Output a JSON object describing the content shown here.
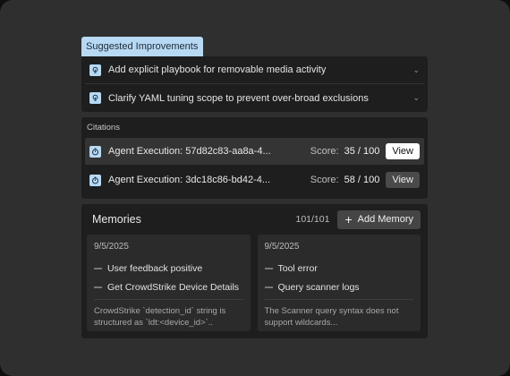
{
  "suggested_improvements": {
    "label": "Suggested Improvements",
    "items": [
      {
        "text": "Add explicit playbook for removable media activity"
      },
      {
        "text": "Clarify YAML tuning scope to prevent over-broad exclusions"
      }
    ]
  },
  "citations": {
    "title": "Citations",
    "items": [
      {
        "name": "Agent Execution: 57d82c83-aa8a-4...",
        "score_label": "Score:",
        "score": "35 / 100",
        "view_label": "View"
      },
      {
        "name": "Agent Execution: 3dc18c86-bd42-4...",
        "score_label": "Score:",
        "score": "58 / 100",
        "view_label": "View"
      }
    ]
  },
  "memories": {
    "title": "Memories",
    "count": "101/101",
    "add_label": "Add Memory",
    "cards": [
      {
        "date": "9/5/2025",
        "items": [
          "User feedback positive",
          "Get CrowdStrike Device Details"
        ],
        "description": "CrowdStrike `detection_id` string is structured as `ldt:<device_id>`.."
      },
      {
        "date": "9/5/2025",
        "items": [
          "Tool error",
          "Query scanner logs"
        ],
        "description": "The Scanner query syntax does not support wildcards..."
      }
    ]
  },
  "colors": {
    "accent": "#b7d9f4",
    "panel": "#1e1e1e",
    "frame": "#2f2f2f"
  }
}
